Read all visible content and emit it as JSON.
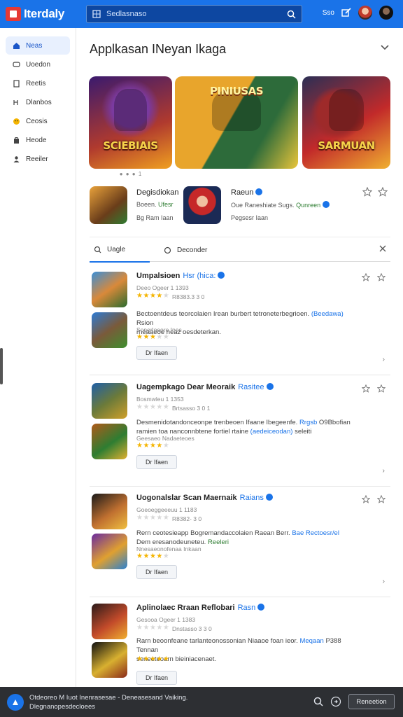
{
  "header": {
    "app_name": "Iterdaly",
    "search_placeholder": "Sedlasnaso",
    "link": "Sso"
  },
  "sidebar": {
    "items": [
      {
        "label": "Neas",
        "icon": "home-icon",
        "active": true
      },
      {
        "label": "Uoedon",
        "icon": "chat-icon"
      },
      {
        "label": "Reetis",
        "icon": "document-icon"
      },
      {
        "label": "Dlanbos",
        "icon": "gamepad-icon"
      },
      {
        "label": "Ceosis",
        "icon": "emoji-icon"
      },
      {
        "label": "Heode",
        "icon": "bag-icon"
      },
      {
        "label": "Reeiler",
        "icon": "user-icon"
      }
    ]
  },
  "main": {
    "title": "Applkasan INeyan Ikaga",
    "banners": [
      {
        "title": "SCIEBIAIS"
      },
      {
        "title": "PINIUSAS"
      },
      {
        "title": "SARMUAN"
      }
    ],
    "carousel_indicator": "● ● ● 1",
    "featured": [
      {
        "name": "Degisdiokan",
        "sub": "Boeen.",
        "sub_hl": "Ufesr",
        "sub2": "Bg Ram Iaan"
      },
      {
        "name": "Raeun",
        "sub": "Oue Raneshiate Sugs.",
        "sub_hl": "Qunreen",
        "sub2": "Pegsesr Iaan"
      }
    ],
    "tabs": [
      {
        "label": "Uagle",
        "active": true
      },
      {
        "label": "Deconder",
        "active": false
      }
    ]
  },
  "cards": [
    {
      "title": "Umpalsioen",
      "tag": "Hsr (hica:",
      "meta1": "Deeo Ogeer 1 1393",
      "rating1": 4,
      "rating1_text": "R8383.3 3 0",
      "desc1": "Bectoentdeus teorcolaien Irean burbert tetroneterbegrioen.",
      "desc_link": "(Beedawa)",
      "desc2": "Rsion",
      "desc3": "rneaaeoe neaz oesdeterkan.",
      "meta2": "Sonerloeore Ines",
      "rating2": 3,
      "button": "Dr Ifaen"
    },
    {
      "title": "Uagempkago Dear Meoraik",
      "tag": "Rasitee",
      "meta1": "Bosmwleu 1 1353",
      "rating1": 0,
      "rating1_text": "Brtsasso 3 0 1",
      "desc1": "Desmenidotandonceonpe trenbeoen Ifaane Ibegeenfe.",
      "desc_link": "Rrgsb",
      "desc2": "O9Bbofian",
      "desc3": "ramien toa nanconnbtene fortiel rtaine",
      "desc_link2": "(aedeiceodan)",
      "desc3b": "seleiti",
      "meta2": "Geesaeo Nadaeteoes",
      "rating2": 4,
      "button": "Dr Ifaen"
    },
    {
      "title": "Uogonalslar Scan Maernaik",
      "tag": "Raians",
      "meta1": "Goeoeggeeeuu 1 1183",
      "rating1": 0,
      "rating1_text": "R8382- 3 0",
      "desc1": "Rern ceotesieapp Bogremandaccolaien Raean Berr.",
      "desc_link": "Bae Rectoesr/el",
      "desc2": "",
      "desc3": "Dem eresanodeuneteu.",
      "desc_link2": "Reeleri",
      "desc3b": "",
      "meta2": "Nnesaeonofenaa Inkaan",
      "rating2": 4,
      "button": "Dr Ifaen"
    },
    {
      "title": "Aplinolaec Rraan Reflobari",
      "tag": "Rasn",
      "meta1": "Gesooa Ogeer 1 1383",
      "rating1": 0,
      "rating1_text": "Dnstasso 3 3 0",
      "desc1": "Rarn beoonfeane tarlanteonossonian Niaaoe foan ieor.",
      "desc_link": "Meqaan",
      "desc2": "P388 Tennan",
      "desc3": "seneeteoarn bieiniacenaet.",
      "meta2": "",
      "rating2": 5,
      "button": "Dr Ifaen"
    }
  ],
  "bottombar": {
    "line1": "Otdeoreo M Iuot Inenrasesae - Deneasesand Vaiking.",
    "line2": "Dlegnanopesdecloees",
    "button": "Reneetion"
  },
  "colors": {
    "brand": "#1a73e8",
    "accent_star": "#f4b400",
    "bottom_bg": "#2d2f33"
  }
}
